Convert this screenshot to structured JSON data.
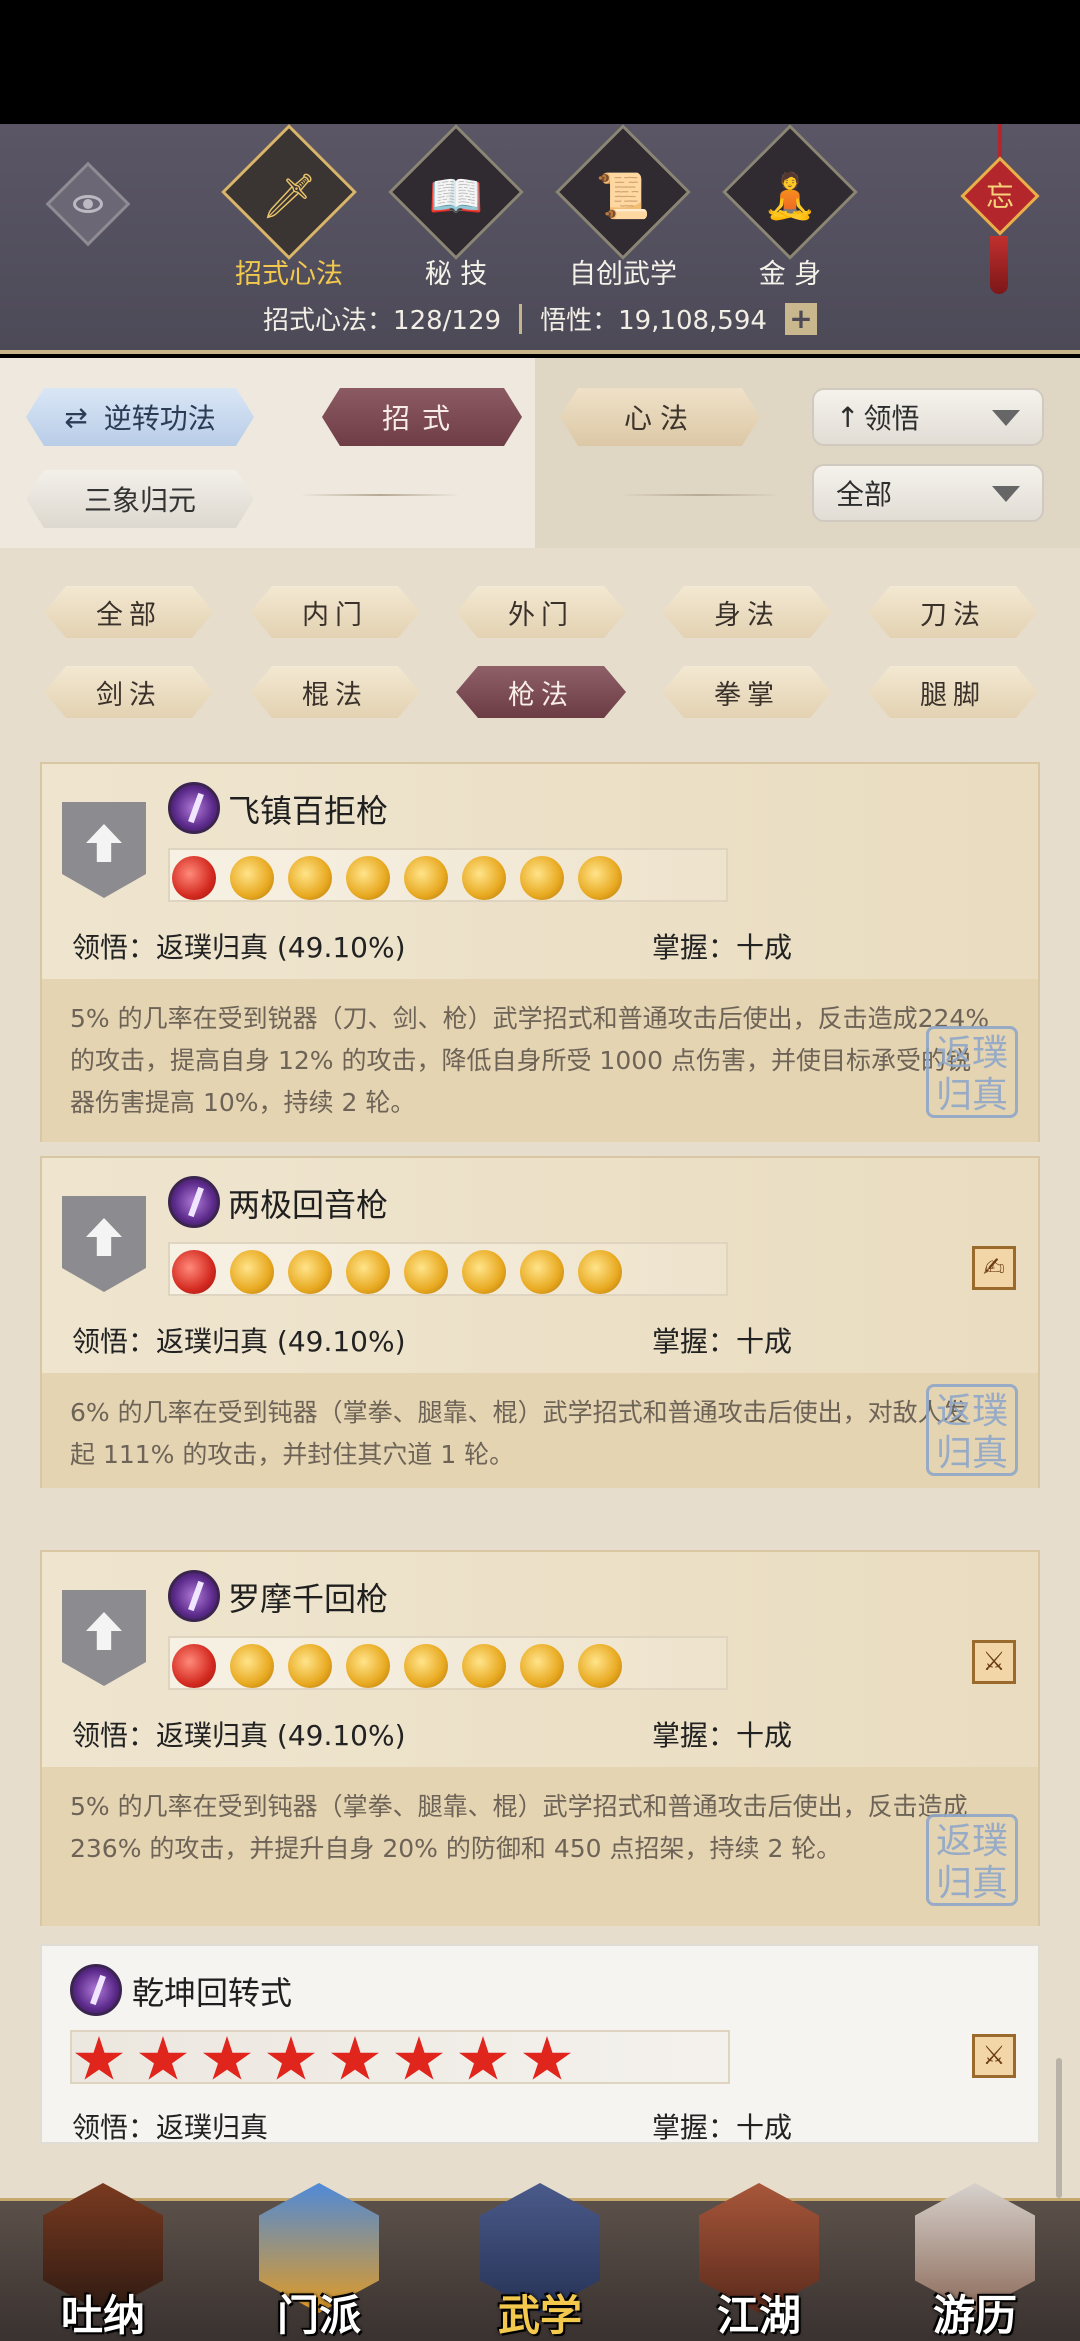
{
  "header": {
    "tabs": [
      {
        "label": "招式心法",
        "icon": "sword-icon",
        "glyph": "🗡"
      },
      {
        "label": "秘 技",
        "icon": "book-icon",
        "glyph": "📖"
      },
      {
        "label": "自创武学",
        "icon": "scroll-brush-icon",
        "glyph": "📜"
      },
      {
        "label": "金 身",
        "icon": "meditation-icon",
        "glyph": "🧘"
      }
    ],
    "knot_char": "忘",
    "stats": {
      "moves_label": "招式心法：128/129",
      "insight_label": "悟性：19,108,594",
      "plus": "+"
    }
  },
  "toolbar": {
    "reverse_label": "逆转功法",
    "moves_tab": "招式",
    "mind_tab": "心法",
    "sort_dropdown": "领悟",
    "formation_label": "三象归元",
    "filter_dropdown": "全部"
  },
  "filters": [
    "全部",
    "内门",
    "外门",
    "身法",
    "刀法",
    "剑法",
    "棍法",
    "枪法",
    "拳掌",
    "腿脚"
  ],
  "active_filter": "枪法",
  "cards": [
    {
      "name": "飞镇百拒枪",
      "insight": "领悟：返璞归真 (49.10%)",
      "mastery": "掌握：十成",
      "desc": "5% 的几率在受到锐器（刀、剑、枪）武学招式和普通攻击后使出，反击造成224% 的攻击，提高自身 12% 的攻击，降低自身所受 1000 点伤害，并使目标承受的锐器伤害提高 10%，持续 2 轮。",
      "seal": "返璞归真"
    },
    {
      "name": "两极回音枪",
      "insight": "领悟：返璞归真 (49.10%)",
      "mastery": "掌握：十成",
      "desc": "6% 的几率在受到钝器（掌拳、腿靠、棍）武学招式和普通攻击后使出，对敌人发起 111% 的攻击，并封住其穴道 1 轮。",
      "weapon_icon": "✍",
      "seal": "返璞归真"
    },
    {
      "name": "罗摩千回枪",
      "insight": "领悟：返璞归真 (49.10%)",
      "mastery": "掌握：十成",
      "desc": "5% 的几率在受到钝器（掌拳、腿靠、棍）武学招式和普通攻击后使出，反击造成 236% 的攻击，并提升自身 20% 的防御和 450 点招架，持续 2 轮。",
      "weapon_icon": "⚔",
      "seal": "返璞归真"
    },
    {
      "name": "乾坤回转式",
      "insight": "领悟：返璞归真",
      "mastery": "掌握：十成",
      "weapon_icon": "⚔"
    }
  ],
  "bottom_nav": [
    "吐纳",
    "门派",
    "武学",
    "江湖",
    "游历"
  ]
}
